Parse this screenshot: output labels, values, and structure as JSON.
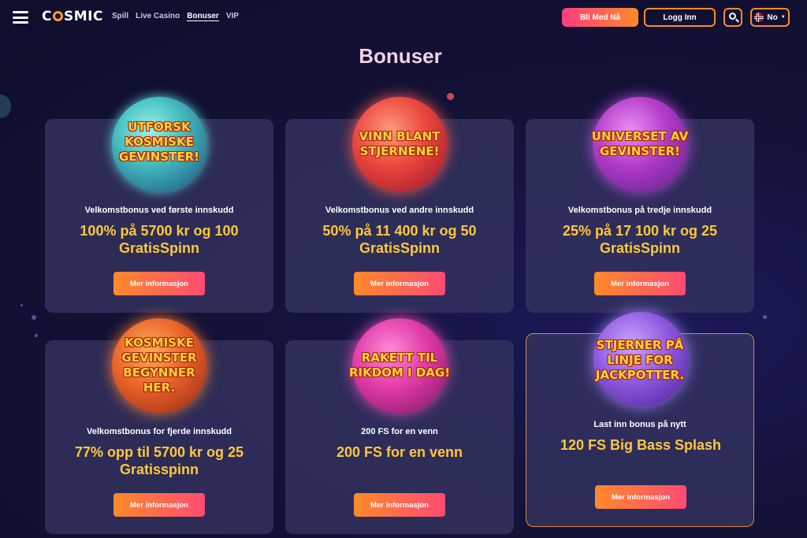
{
  "header": {
    "logo_text_1": "C",
    "logo_text_2": "SMIC",
    "nav": [
      {
        "label": "Spill"
      },
      {
        "label": "Live Casino"
      },
      {
        "label": "Bonuser"
      },
      {
        "label": "VIP"
      }
    ],
    "join_label": "Bli Med Nå",
    "login_label": "Logg Inn",
    "lang_label": "No",
    "icons": [
      "hamburger-menu-icon",
      "search-icon",
      "norway-flag-icon",
      "chevron-down-icon"
    ]
  },
  "page_title": "Bonuser",
  "cards": [
    {
      "planet_text": "UTFORSK KOSMISKE GEVINSTER!",
      "planet_color": "#4cc6c4",
      "subtitle": "Velkomstbonus ved første innskudd",
      "offer": "100% på 5700 kr og 100 GratisSpinn",
      "button": "Mer informasjon"
    },
    {
      "planet_text": "VINN BLANT STJERNENE!",
      "planet_color": "#e9453c",
      "subtitle": "Velkomstbonus ved andre innskudd",
      "offer": "50% på 11 400 kr og 50 GratisSpinn",
      "button": "Mer informasjon"
    },
    {
      "planet_text": "UNIVERSET AV GEVINSTER!",
      "planet_color": "#b03ac6",
      "subtitle": "Velkomstbonus på tredje innskudd",
      "offer": "25% på 17 100 kr og 25 GratisSpinn",
      "button": "Mer informasjon"
    },
    {
      "planet_text": "KOSMISKE GEVINSTER BEGYNNER HER.",
      "planet_color": "#e8622a",
      "subtitle": "Velkomstbonus for fjerde innskudd",
      "offer": "77% opp til 5700 kr og 25 Gratisspinn",
      "button": "Mer informasjon"
    },
    {
      "planet_text": "RAKETT TIL RIKDOM I DAG!",
      "planet_color": "#e03aa6",
      "subtitle": "200 FS for en venn",
      "offer": "200 FS for en venn",
      "button": "Mer informasjon"
    },
    {
      "planet_text": "STJERNER PÅ LINJE FOR JACKPOTTER.",
      "planet_color": "#8f5ae0",
      "subtitle": "Last inn bonus på nytt",
      "offer": "120 FS Big Bass Splash",
      "button": "Mer informasjon"
    }
  ],
  "colors": {
    "accent": "#ff8a2a",
    "accent_pink": "#ff3d7f",
    "offer_text": "#ffc83a",
    "card_bg": "#34345f",
    "page_bg": "#131238"
  }
}
